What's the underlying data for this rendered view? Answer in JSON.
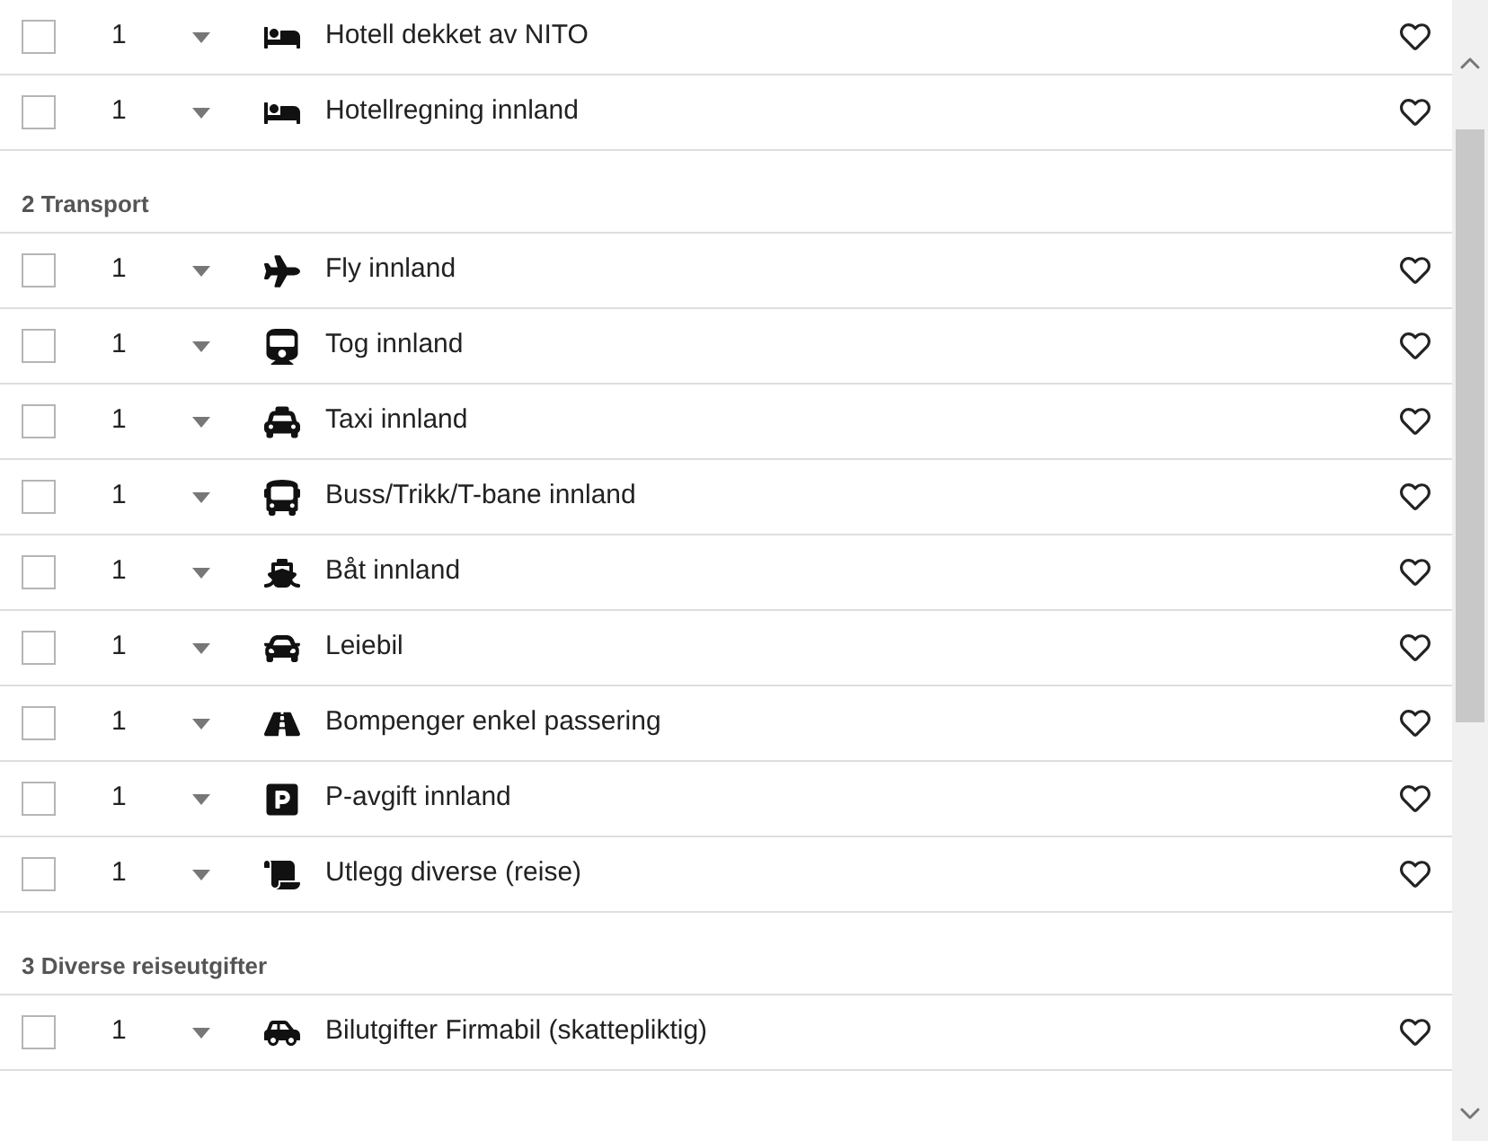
{
  "groups": [
    {
      "rows": [
        {
          "kind": "bed",
          "label": "Hotell dekket av NITO",
          "quantity": "1",
          "checked": false,
          "favorite": false
        },
        {
          "kind": "bed",
          "label": "Hotellregning innland",
          "quantity": "1",
          "checked": false,
          "favorite": false
        }
      ]
    },
    {
      "heading": "2 Transport",
      "rows": [
        {
          "kind": "plane",
          "label": "Fly innland",
          "quantity": "1",
          "checked": false,
          "favorite": false
        },
        {
          "kind": "train",
          "label": "Tog innland",
          "quantity": "1",
          "checked": false,
          "favorite": false
        },
        {
          "kind": "taxi",
          "label": "Taxi innland",
          "quantity": "1",
          "checked": false,
          "favorite": false
        },
        {
          "kind": "bus",
          "label": "Buss/Trikk/T-bane innland",
          "quantity": "1",
          "checked": false,
          "favorite": false
        },
        {
          "kind": "ship",
          "label": "Båt innland",
          "quantity": "1",
          "checked": false,
          "favorite": false
        },
        {
          "kind": "car",
          "label": "Leiebil",
          "quantity": "1",
          "checked": false,
          "favorite": false
        },
        {
          "kind": "toll",
          "label": "Bompenger enkel passering",
          "quantity": "1",
          "checked": false,
          "favorite": false
        },
        {
          "kind": "parking",
          "label": "P-avgift innland",
          "quantity": "1",
          "checked": false,
          "favorite": false
        },
        {
          "kind": "scroll",
          "label": "Utlegg diverse (reise)",
          "quantity": "1",
          "checked": false,
          "favorite": false
        }
      ]
    },
    {
      "heading": "3 Diverse reiseutgifter",
      "rows": [
        {
          "kind": "carcost",
          "label": "Bilutgifter Firmabil (skattepliktig)",
          "quantity": "1",
          "checked": false,
          "favorite": false
        }
      ]
    }
  ]
}
